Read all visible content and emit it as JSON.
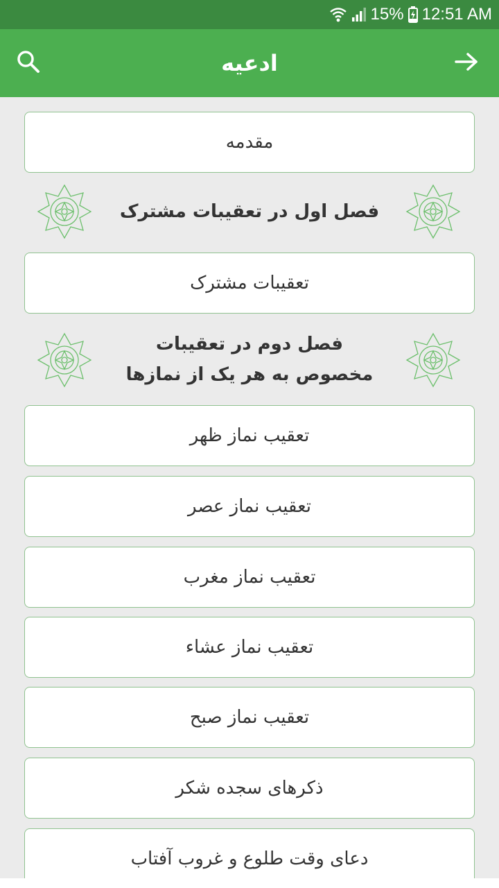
{
  "status_bar": {
    "battery": "15%",
    "time": "12:51 AM",
    "icons": [
      "wifi-icon",
      "signal-icon",
      "battery-charging-icon"
    ]
  },
  "app_bar": {
    "title": "ادعیه",
    "left_icon": "search-icon",
    "right_icon": "arrow-back-icon",
    "color": "#4caf50"
  },
  "items": [
    {
      "label": "مقدمه"
    },
    {
      "section": "فصل اول در تعقیبات مشترک"
    },
    {
      "label": "تعقیبات مشترک"
    },
    {
      "section": "فصل دوم در تعقیبات مخصوص به هر یک از نمازها"
    },
    {
      "label": "تعقیب نماز ظهر"
    },
    {
      "label": "تعقیب نماز عصر"
    },
    {
      "label": "تعقیب نماز مغرب"
    },
    {
      "label": "تعقیب نماز عشاء"
    },
    {
      "label": "تعقیب نماز صبح"
    },
    {
      "label": "ذکرهای سجده شکر"
    },
    {
      "label": "دعای وقت طلوع و غروب آفتاب"
    }
  ],
  "colors": {
    "status_bar": "#3b8a40",
    "accent": "#4caf50",
    "card_border": "#8fc28f",
    "ornament": "#6cbf6c",
    "background": "#ebebeb"
  }
}
